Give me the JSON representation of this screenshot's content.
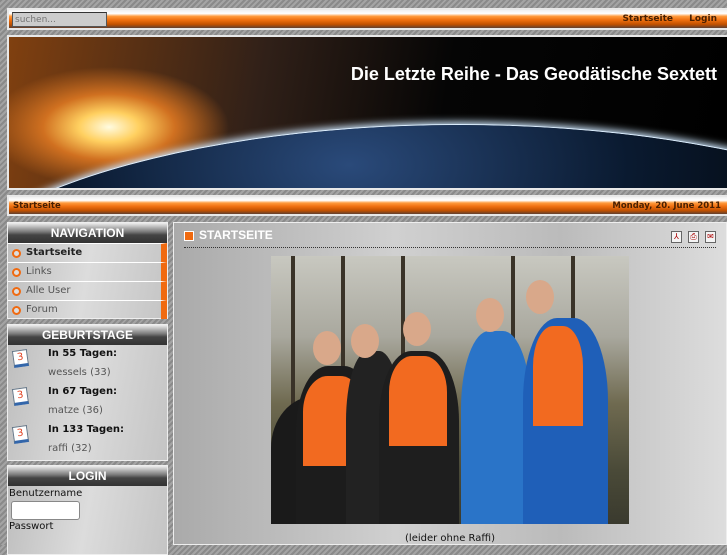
{
  "topbar": {
    "search_placeholder": "suchen...",
    "links": [
      "Startseite",
      "Login"
    ]
  },
  "banner": {
    "title": "Die Letzte Reihe - Das Geodätische Sextett"
  },
  "breadcrumb": {
    "current": "Startseite",
    "date": "Monday, 20. June 2011"
  },
  "navigation": {
    "title": "NAVIGATION",
    "items": [
      "Startseite",
      "Links",
      "Alle User",
      "Forum"
    ]
  },
  "birthdays": {
    "title": "GEBURTSTAGE",
    "items": [
      {
        "when": "In 55 Tagen:",
        "who": "wessels (33)"
      },
      {
        "when": "In 67 Tagen:",
        "who": "matze (36)"
      },
      {
        "when": "In 133 Tagen:",
        "who": "raffi (32)"
      }
    ],
    "calendar_digit": "3"
  },
  "login": {
    "title": "LOGIN",
    "username_label": "Benutzername",
    "password_label": "Passwort"
  },
  "main": {
    "title": "STARTSEITE",
    "caption": "(leider ohne Raffi)",
    "icons": [
      "pdf-icon",
      "print-icon",
      "email-icon"
    ]
  },
  "colors": {
    "accent": "#f06a10"
  }
}
